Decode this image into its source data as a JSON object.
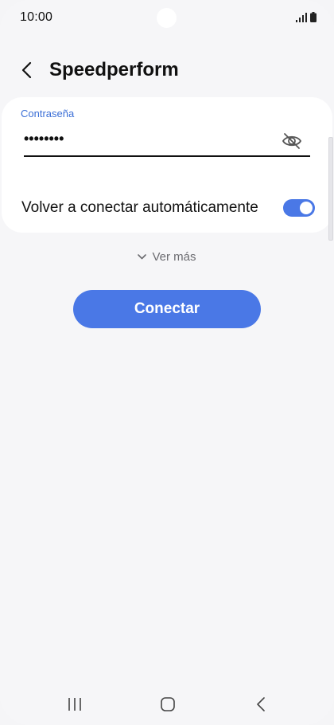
{
  "status_bar": {
    "time": "10:00",
    "icons": [
      "signal-icon",
      "battery-icon"
    ]
  },
  "header": {
    "back_icon": "back-arrow-icon",
    "title": "Speedperform"
  },
  "form": {
    "password_label": "Contraseña",
    "password_value": "••••••••",
    "visibility_icon": "eye-off-icon",
    "auto_reconnect_label": "Volver a conectar automáticamente",
    "auto_reconnect_enabled": true
  },
  "see_more": {
    "label": "Ver más",
    "icon": "chevron-down-icon"
  },
  "actions": {
    "connect_label": "Conectar"
  },
  "nav_bar": {
    "icons": [
      "recent-apps-icon",
      "home-icon",
      "back-icon"
    ]
  },
  "colors": {
    "accent": "#4a78e6",
    "label_blue": "#3a6ed6",
    "background": "#f6f6f8",
    "card": "#ffffff"
  }
}
